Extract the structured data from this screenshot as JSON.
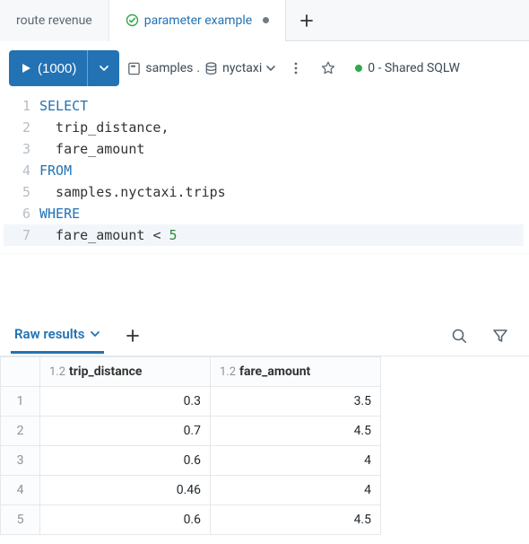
{
  "tabs": {
    "items": [
      {
        "label": "route revenue",
        "active": false
      },
      {
        "label": "parameter example",
        "active": true,
        "dirty": true
      }
    ],
    "add_tooltip": "+"
  },
  "toolbar": {
    "run_label": "(1000)",
    "catalog_text": "samples",
    "schema_text": "nyctaxi",
    "cluster_label": "0 - Shared SQLW"
  },
  "editor": {
    "lines": [
      {
        "n": "1",
        "tokens": [
          [
            "kw",
            "SELECT"
          ]
        ]
      },
      {
        "n": "2",
        "tokens": [
          [
            "ident",
            "  trip_distance"
          ],
          [
            "punct",
            ","
          ]
        ]
      },
      {
        "n": "3",
        "tokens": [
          [
            "ident",
            "  fare_amount"
          ]
        ]
      },
      {
        "n": "4",
        "tokens": [
          [
            "kw",
            "FROM"
          ]
        ]
      },
      {
        "n": "5",
        "tokens": [
          [
            "ident",
            "  samples.nyctaxi.trips"
          ]
        ]
      },
      {
        "n": "6",
        "tokens": [
          [
            "kw",
            "WHERE"
          ]
        ]
      },
      {
        "n": "7",
        "tokens": [
          [
            "ident",
            "  fare_amount "
          ],
          [
            "punct",
            "< "
          ],
          [
            "num",
            "5"
          ]
        ],
        "current": true
      }
    ]
  },
  "results": {
    "tab_label": "Raw results",
    "columns": [
      {
        "type": "1.2",
        "name": "trip_distance"
      },
      {
        "type": "1.2",
        "name": "fare_amount"
      }
    ],
    "rows": [
      {
        "n": "1",
        "values": [
          "0.3",
          "3.5"
        ]
      },
      {
        "n": "2",
        "values": [
          "0.7",
          "4.5"
        ]
      },
      {
        "n": "3",
        "values": [
          "0.6",
          "4"
        ]
      },
      {
        "n": "4",
        "values": [
          "0.46",
          "4"
        ]
      },
      {
        "n": "5",
        "values": [
          "0.6",
          "4.5"
        ]
      }
    ]
  }
}
